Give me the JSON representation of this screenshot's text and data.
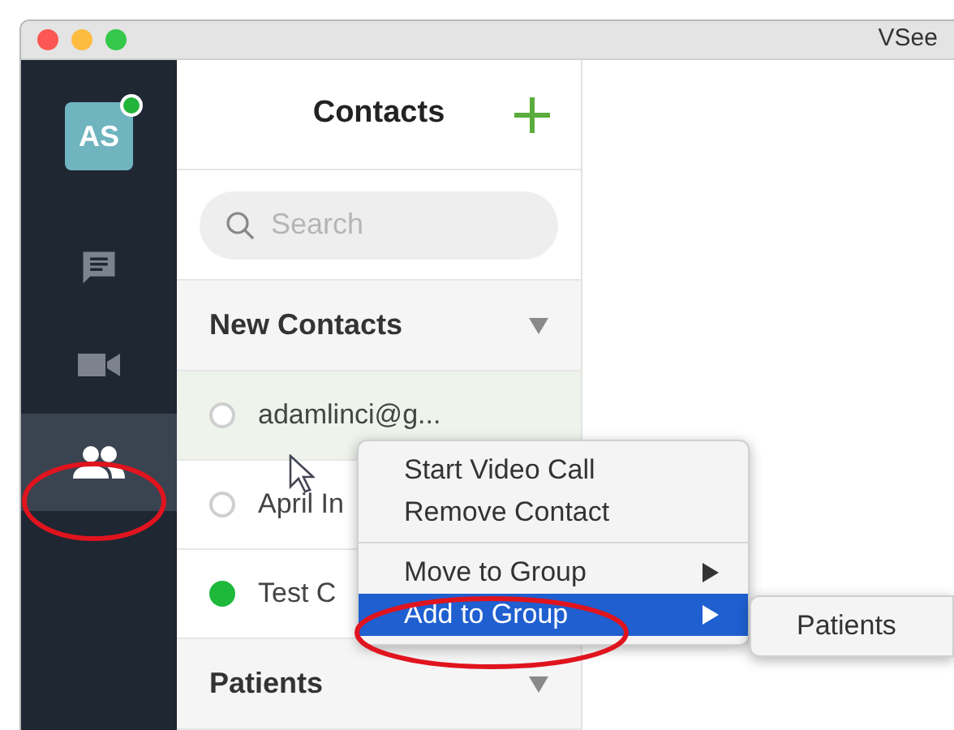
{
  "window": {
    "title": "VSee"
  },
  "sidebar": {
    "avatar": {
      "initials": "AS",
      "online": true
    },
    "items": [
      {
        "kind": "chat",
        "selected": false
      },
      {
        "kind": "video",
        "selected": false
      },
      {
        "kind": "contacts",
        "selected": true
      }
    ]
  },
  "contacts": {
    "title": "Contacts",
    "search": {
      "placeholder": "Search"
    },
    "sections": [
      {
        "title": "New Contacts",
        "contacts": [
          {
            "name": "adamlinci@g...",
            "online": false,
            "selected": true
          },
          {
            "name": "April In",
            "online": false,
            "selected": false
          },
          {
            "name": "Test C",
            "online": true,
            "selected": false
          }
        ]
      },
      {
        "title": "Patients"
      }
    ]
  },
  "context_menu": {
    "groups": [
      [
        {
          "label": "Start Video Call",
          "submenu": false,
          "selected": false
        },
        {
          "label": "Remove Contact",
          "submenu": false,
          "selected": false
        }
      ],
      [
        {
          "label": "Move to Group",
          "submenu": true,
          "selected": false
        },
        {
          "label": "Add to Group",
          "submenu": true,
          "selected": true
        }
      ]
    ],
    "submenu": {
      "items": [
        "Patients"
      ]
    }
  }
}
